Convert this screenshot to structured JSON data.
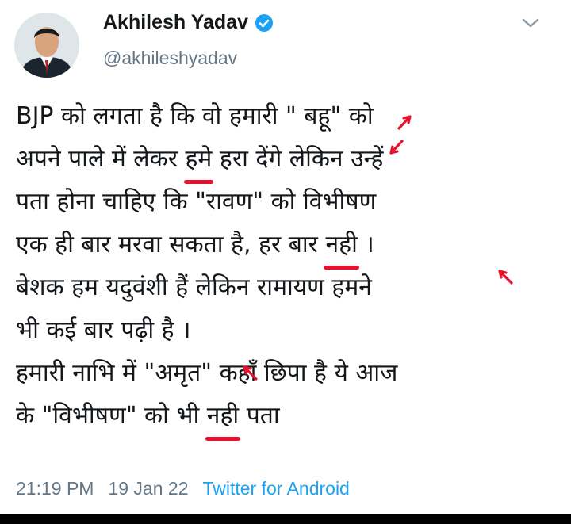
{
  "author": {
    "name": "Akhilesh Yadav",
    "handle": "@akhileshyadav"
  },
  "tweet": {
    "lines": [
      [
        {
          "t": "BJP को लगता है कि वो हमारी \""
        },
        {
          "t": " बहू\" को"
        }
      ],
      [
        {
          "t": "अपने पाले में लेकर "
        },
        {
          "t": "हमे",
          "u": true
        },
        {
          "t": " हरा देंगे लेकिन उन्हें"
        }
      ],
      [
        {
          "t": "पता होना चाहिए कि \"रावण\" को विभीषण"
        }
      ],
      [
        {
          "t": "एक ही बार मरवा सकता है, हर बार "
        },
        {
          "t": "नही",
          "u": true
        },
        {
          "t": " ।"
        }
      ],
      [
        {
          "t": "बेशक हम यदुवंशी हैं लेकिन रामायण हमने"
        }
      ],
      [
        {
          "t": "भी कई बार पढ़ी है ।"
        }
      ],
      [
        {
          "t": "हमारी नाभि में \"अमृत\" कहाँ छिपा है ये आज"
        }
      ],
      [
        {
          "t": "के \"विभीषण\" को भी "
        },
        {
          "t": "नही",
          "u": true
        },
        {
          "t": " पता"
        }
      ]
    ]
  },
  "meta": {
    "time": "21:19 PM",
    "date": "19 Jan 22",
    "source": "Twitter for Android"
  },
  "colors": {
    "verified_blue": "#1da1f2",
    "annotation_red": "#e8112d",
    "meta_gray": "#657786"
  },
  "icons": {
    "verified": "verified-badge-icon",
    "caret": "chevron-down-icon"
  }
}
